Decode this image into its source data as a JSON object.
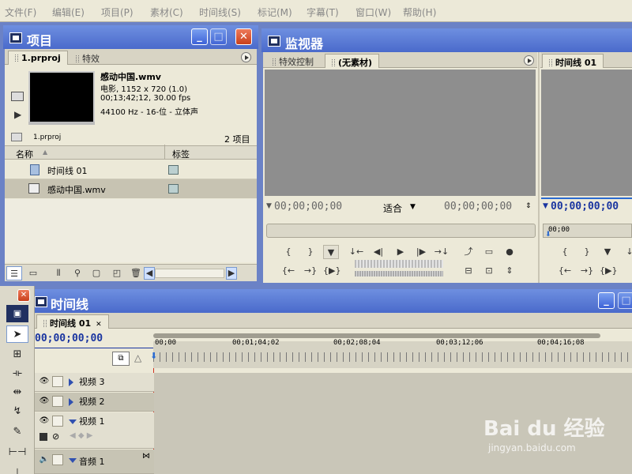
{
  "menu": [
    "文件(F)",
    "编辑(E)",
    "项目(P)",
    "素材(C)",
    "时间线(S)",
    "标记(M)",
    "字幕(T)",
    "窗口(W)",
    "帮助(H)"
  ],
  "project_panel": {
    "title": "项目",
    "tabs": [
      "1.prproj",
      "特效"
    ],
    "clip_name": "感动中国.wmv",
    "clip_info_1": "电影, 1152 x 720 (1.0)",
    "clip_info_2": "00;13;42;12, 30.00 fps",
    "clip_info_3": "44100 Hz - 16-位 - 立体声",
    "path": "1.prproj",
    "item_count": "2 项目",
    "col_name": "名称",
    "col_label": "标签",
    "items": [
      {
        "name": "时间线 01",
        "icon": "sequence-icon"
      },
      {
        "name": "感动中国.wmv",
        "icon": "video-clip-icon"
      }
    ]
  },
  "monitor": {
    "title": "监视器",
    "source_tabs": [
      "特效控制",
      "(无素材)"
    ],
    "program_tab": "时间线 01",
    "source_timecode": "00;00;00;00",
    "fit_label": "适合",
    "source_duration": "00;00;00;00",
    "program_timecode": "00;00;00;00",
    "program_ruler": "00;00"
  },
  "timeline": {
    "title": "时间线",
    "tab": "时间线 01",
    "timecode": "00;00;00;00",
    "ruler": [
      "00;00",
      "00;01;04;02",
      "00;02;08;04",
      "00;03;12;06",
      "00;04;16;08"
    ],
    "tracks": [
      "视频 3",
      "视频 2",
      "视频 1",
      "音频 1"
    ]
  },
  "watermark": {
    "brand": "Bai du 经验",
    "url": "jingyan.baidu.com"
  },
  "colors": {
    "workspace": "#6b82c6",
    "panel": "#ece9d8",
    "title_bar": "#4a6acb",
    "timecode": "#1a35a0",
    "playhead": "#d03020"
  }
}
